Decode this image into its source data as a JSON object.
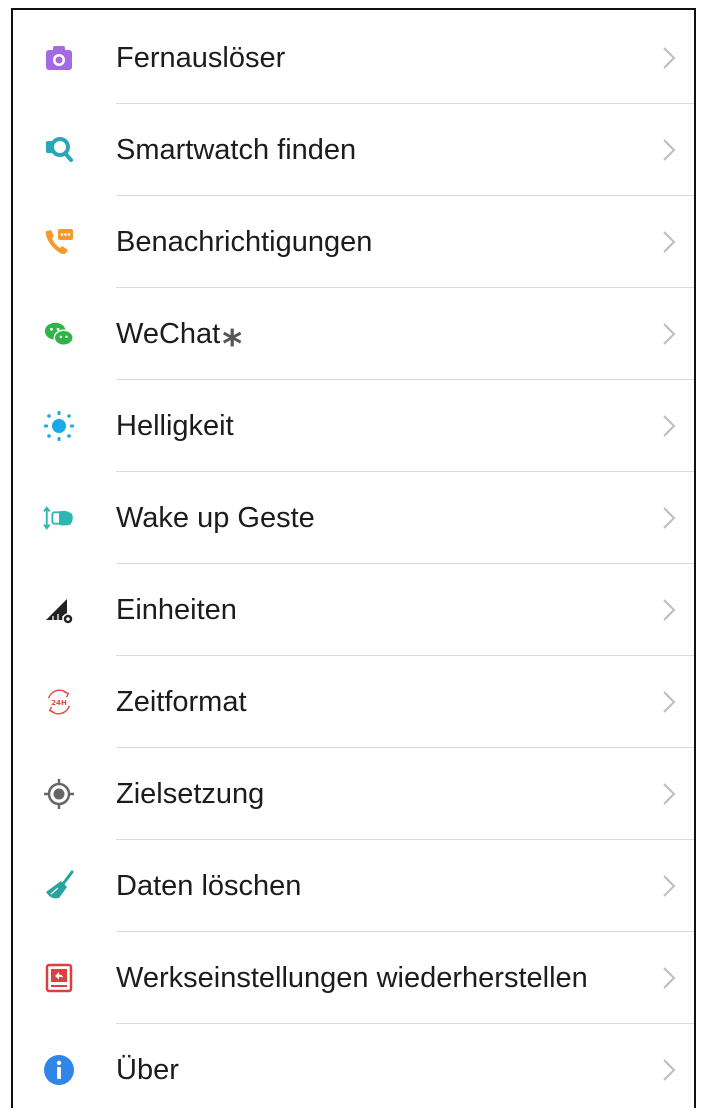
{
  "menu": {
    "items": [
      {
        "label": "Fernauslöser",
        "icon": "camera-icon",
        "color": "#a46be0"
      },
      {
        "label": "Smartwatch finden",
        "icon": "find-watch-icon",
        "color": "#2aa7b6"
      },
      {
        "label": "Benachrichtigungen",
        "icon": "notification-phone-icon",
        "color": "#f39a2e"
      },
      {
        "label": "WeChat",
        "icon": "wechat-icon",
        "color": "#2fb547",
        "annotation": "*"
      },
      {
        "label": "Helligkeit",
        "icon": "brightness-icon",
        "color": "#1ba9e8"
      },
      {
        "label": "Wake up Geste",
        "icon": "wake-gesture-icon",
        "color": "#2db7b0"
      },
      {
        "label": "Einheiten",
        "icon": "units-icon",
        "color": "#222222"
      },
      {
        "label": "Zeitformat",
        "icon": "time-format-icon",
        "color": "#e24a3a",
        "icon_text": "24H"
      },
      {
        "label": "Zielsetzung",
        "icon": "target-icon",
        "color": "#666666"
      },
      {
        "label": "Daten löschen",
        "icon": "broom-icon",
        "color": "#27a59b"
      },
      {
        "label": "Werkseinstellungen wiederherstellen",
        "icon": "factory-reset-icon",
        "color": "#d94040"
      },
      {
        "label": "Über",
        "icon": "info-icon",
        "color": "#2f86e8"
      }
    ]
  }
}
